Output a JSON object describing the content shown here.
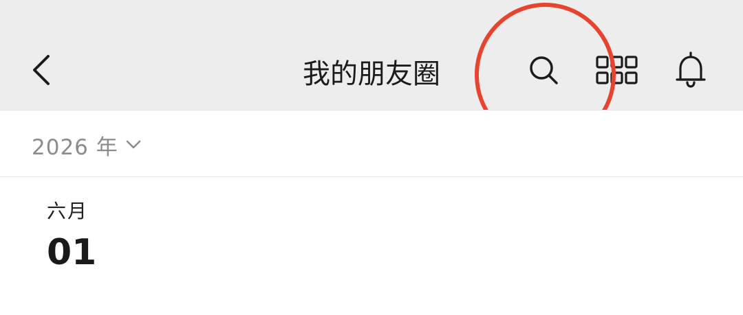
{
  "header": {
    "title": "我的朋友圈",
    "background_color": "#ededed",
    "icons": {
      "back": "chevron-left-icon",
      "search": "search-icon",
      "apps": "grid-apps-icon",
      "bell": "bell-icon"
    }
  },
  "annotation": {
    "highlight_color": "#e8432f",
    "highlight_target": "search-icon"
  },
  "year_bar": {
    "year_label": "2026 年",
    "dropdown_icon": "chevron-down-icon"
  },
  "timeline": {
    "month": "六月",
    "day": "01"
  }
}
